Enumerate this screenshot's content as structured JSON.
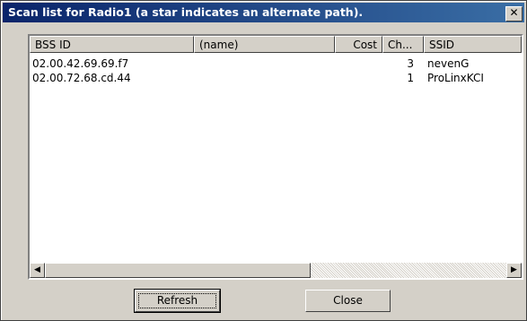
{
  "window": {
    "title": "Scan list for Radio1 (a star indicates an alternate path).",
    "close_glyph": "✕"
  },
  "list": {
    "columns": [
      "BSS ID",
      "(name)",
      "Cost",
      "Ch...",
      "SSID"
    ],
    "rows": [
      {
        "bssid": "02.00.42.69.69.f7",
        "name": "",
        "cost": "",
        "channel": "3",
        "ssid": "nevenG"
      },
      {
        "bssid": "02.00.72.68.cd.44",
        "name": "",
        "cost": "",
        "channel": "1",
        "ssid": "ProLinxKCI"
      }
    ]
  },
  "buttons": {
    "refresh": "Refresh",
    "close": "Close"
  }
}
